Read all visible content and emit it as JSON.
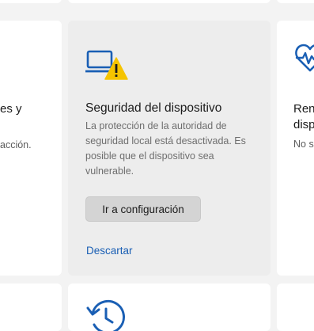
{
  "left_card": {
    "title_fragment": "es y",
    "description_fragment": "acción."
  },
  "center_card": {
    "icon": "laptop-warning-icon",
    "title": "Seguridad del dispositivo",
    "description": "La protección de la autoridad de seguridad local está desactivada. Es posible que el dispositivo sea vulnerable.",
    "button_label": "Ir a configuración",
    "dismiss_label": "Descartar"
  },
  "right_card": {
    "icon": "heartbeat-icon",
    "title_line1": "Ren",
    "title_line2": "disp",
    "description_fragment": "No s"
  },
  "bottom_card": {
    "icon": "history-icon"
  },
  "colors": {
    "accent": "#1a5fb4",
    "warning": "#f5c400",
    "page_background": "#f3f3f3",
    "card_background": "#ffffff",
    "hover_card_background": "#ededed",
    "button_background": "#d4d4d4"
  }
}
